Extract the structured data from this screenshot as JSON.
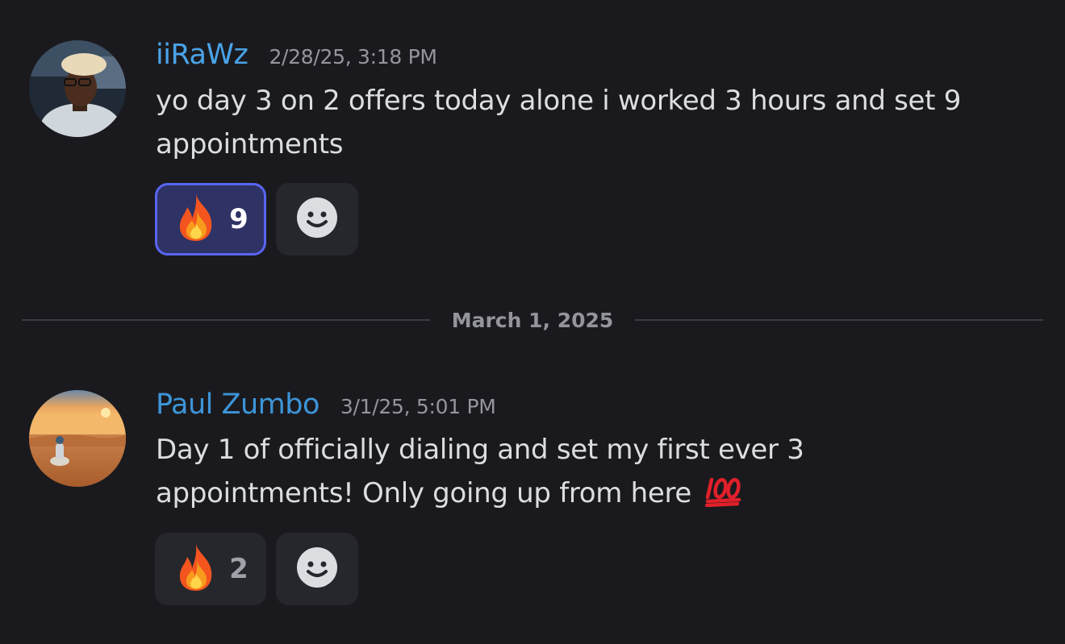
{
  "messages": [
    {
      "username": "iiRaWz",
      "username_color": "#4aa3e8",
      "timestamp": "2/28/25, 3:18 PM",
      "content": "yo day 3 on 2 offers today alone i worked 3 hours and set 9 appointments",
      "reaction": {
        "icon": "fire-emoji",
        "count": "9",
        "active": true
      }
    },
    {
      "username": "Paul Zumbo",
      "username_color": "#3d95d8",
      "timestamp": "3/1/25, 5:01 PM",
      "content": "Day 1 of officially dialing and set my first ever 3 appointments! Only going up from here",
      "trailing_emoji": "hundred-points-emoji",
      "reaction": {
        "icon": "fire-emoji",
        "count": "2",
        "active": false
      }
    }
  ],
  "date_divider": "March 1, 2025",
  "add_reaction_icon": "smiley-icon",
  "colors": {
    "background": "#1a1a1e",
    "active_reaction_border": "#5865f2",
    "active_reaction_bg": "#2f3264",
    "reaction_bg": "#26272d"
  }
}
